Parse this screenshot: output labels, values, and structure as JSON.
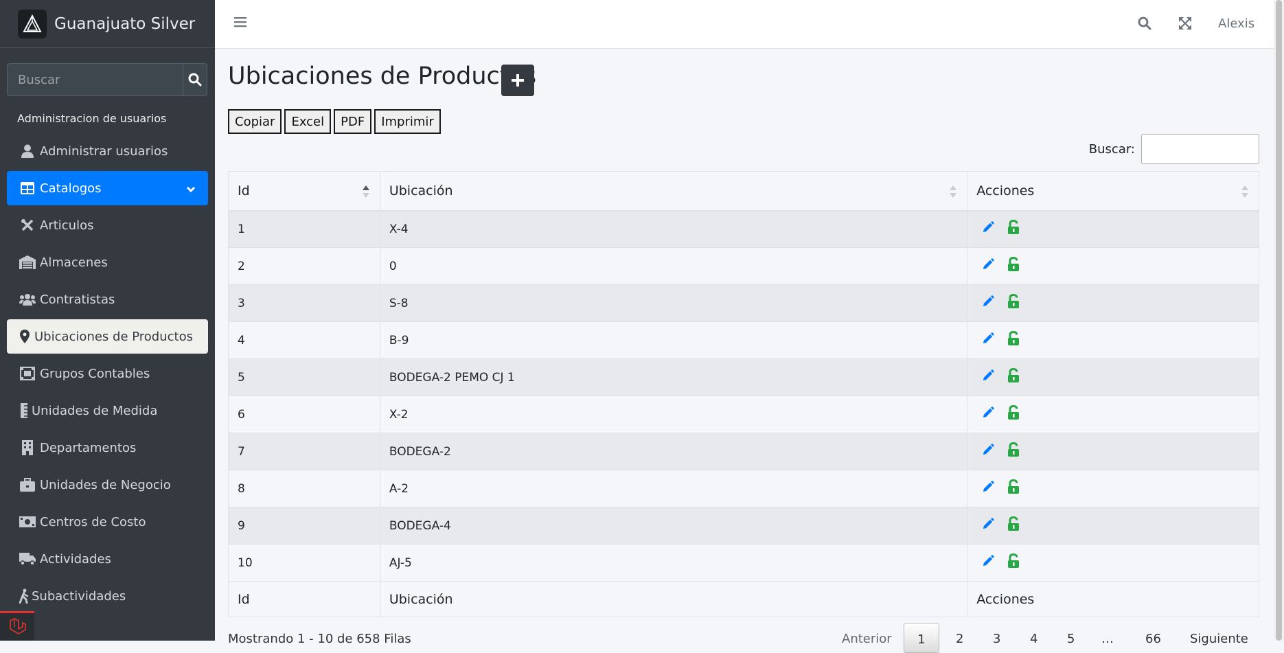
{
  "brand": {
    "name": "Guanajuato Silver",
    "logo_icon": "triangle-logo-icon"
  },
  "sidebar": {
    "search_placeholder": "Buscar",
    "section_header": "Administracion de usuarios",
    "items": [
      {
        "label": "Administrar usuarios",
        "icon": "user-icon",
        "state": "normal"
      },
      {
        "label": "Catalogos",
        "icon": "table-icon",
        "state": "active"
      },
      {
        "label": "Articulos",
        "icon": "tools-icon",
        "state": "normal"
      },
      {
        "label": "Almacenes",
        "icon": "warehouse-icon",
        "state": "normal"
      },
      {
        "label": "Contratistas",
        "icon": "users-icon",
        "state": "normal"
      },
      {
        "label": "Ubicaciones de Productos",
        "icon": "map-marker-icon",
        "state": "current"
      },
      {
        "label": "Grupos Contables",
        "icon": "object-group-icon",
        "state": "normal"
      },
      {
        "label": "Unidades de Medida",
        "icon": "ruler-icon",
        "state": "normal"
      },
      {
        "label": "Departamentos",
        "icon": "building-icon",
        "state": "normal"
      },
      {
        "label": "Unidades de Negocio",
        "icon": "briefcase-icon",
        "state": "normal"
      },
      {
        "label": "Centros de Costo",
        "icon": "money-bill-icon",
        "state": "normal"
      },
      {
        "label": "Actividades",
        "icon": "truck-icon",
        "state": "normal"
      },
      {
        "label": "Subactividades",
        "icon": "walking-icon",
        "state": "normal"
      }
    ]
  },
  "topbar": {
    "user": "Alexis"
  },
  "page": {
    "title": "Ubicaciones de Productos",
    "export_buttons": [
      "Copiar",
      "Excel",
      "PDF",
      "Imprimir"
    ],
    "search_label": "Buscar:"
  },
  "table": {
    "columns": [
      "Id",
      "Ubicación",
      "Acciones"
    ],
    "rows": [
      {
        "id": "1",
        "ubicacion": "X-4"
      },
      {
        "id": "2",
        "ubicacion": "0"
      },
      {
        "id": "3",
        "ubicacion": "S-8"
      },
      {
        "id": "4",
        "ubicacion": "B-9"
      },
      {
        "id": "5",
        "ubicacion": "BODEGA-2 PEMO CJ 1"
      },
      {
        "id": "6",
        "ubicacion": "X-2"
      },
      {
        "id": "7",
        "ubicacion": "BODEGA-2"
      },
      {
        "id": "8",
        "ubicacion": "A-2"
      },
      {
        "id": "9",
        "ubicacion": "BODEGA-4"
      },
      {
        "id": "10",
        "ubicacion": "AJ-5"
      }
    ],
    "footer": [
      "Id",
      "Ubicación",
      "Acciones"
    ]
  },
  "info": "Mostrando 1 - 10 de 658 Filas",
  "pagination": {
    "prev": "Anterior",
    "pages": [
      "1",
      "2",
      "3",
      "4",
      "5",
      "…",
      "66"
    ],
    "next": "Siguiente",
    "current": "1"
  },
  "colors": {
    "sidebar_bg": "#343a40",
    "active": "#007bff",
    "edit": "#007bff",
    "unlock": "#28a745"
  }
}
